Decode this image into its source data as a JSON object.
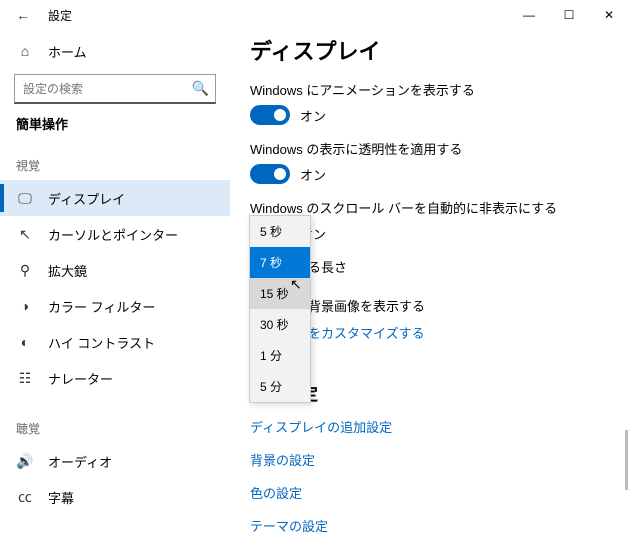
{
  "window": {
    "title": "設定",
    "minimize": "—",
    "maximize": "☐",
    "close": "✕"
  },
  "sidebar": {
    "home": "ホーム",
    "search_placeholder": "設定の検索",
    "category_label": "簡単操作",
    "groups": {
      "vision": "視覚",
      "hearing": "聴覚"
    },
    "items": {
      "display": "ディスプレイ",
      "cursor": "カーソルとポインター",
      "magnifier": "拡大鏡",
      "color_filter": "カラー フィルター",
      "high_contrast": "ハイ コントラスト",
      "narrator": "ナレーター",
      "audio": "オーディオ",
      "captions": "字幕"
    }
  },
  "main": {
    "title": "ディスプレイ",
    "setting1": "Windows にアニメーションを表示する",
    "setting2": "Windows の表示に透明性を適用する",
    "setting3": "Windows のスクロール バーを自動的に非表示にする",
    "on": "オン",
    "duration_partial": "る長さ",
    "bg_partial": "背景画像を表示する",
    "customize_partial": "をカスタマイズする",
    "related_header": "関連設定",
    "links": {
      "display_more": "ディスプレイの追加設定",
      "background": "背景の設定",
      "color": "色の設定",
      "theme": "テーマの設定"
    }
  },
  "dropdown": {
    "opt1": "5 秒",
    "opt2": "7 秒",
    "opt3": "15 秒",
    "opt4": "30 秒",
    "opt5": "1 分",
    "opt6": "5 分"
  }
}
